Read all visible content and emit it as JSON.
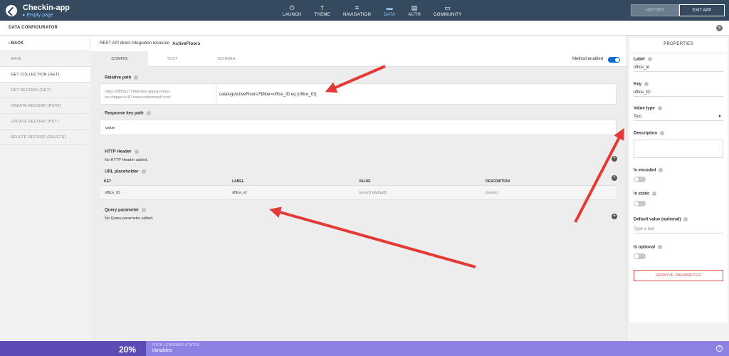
{
  "topbar": {
    "app_title": "Checkin-app",
    "app_subtitle": "▸ Empty page",
    "nav": [
      {
        "label": "LAUNCH",
        "icon": "launch-icon",
        "glyph": "⏻"
      },
      {
        "label": "THEME",
        "icon": "theme-icon",
        "glyph": "†"
      },
      {
        "label": "NAVIGATION",
        "icon": "navigation-icon",
        "glyph": "≡"
      },
      {
        "label": "DATA",
        "icon": "data-icon",
        "glyph": "▬"
      },
      {
        "label": "AUTH",
        "icon": "auth-icon",
        "glyph": "▤"
      },
      {
        "label": "COMMUNITY",
        "icon": "community-icon",
        "glyph": "▭"
      }
    ],
    "active_nav": "DATA",
    "history_label": "HISTORY",
    "exit_label": "EXIT APP"
  },
  "subbar": {
    "title": "DATA CONFIGURATOR"
  },
  "left": {
    "back_label": "‹  BACK",
    "items": [
      {
        "label": "BASE"
      },
      {
        "label": "GET COLLECTION (GET)"
      },
      {
        "label": "GET RECORD (GET)"
      },
      {
        "label": "CREATE RECORD (POST)"
      },
      {
        "label": "UPDATE RECORD (PUT)"
      },
      {
        "label": "DELETE RECORD (DELETE)"
      }
    ],
    "active_item": "GET COLLECTION (GET)"
  },
  "center": {
    "resource_prefix": "REST API direct integration resource",
    "resource_name": "ActiveFloors",
    "tabs": [
      "CONFIG",
      "TEST",
      "SCHEMA"
    ],
    "active_tab": "CONFIG",
    "method_enabled_label": "Method enabled",
    "method_enabled": true,
    "relative_path_label": "Relative path",
    "base_url": "https://9f55d177trial-dev-appgyverapi-srv.cfapps.us10.hana.ondemand.com/",
    "relative_path_value": "catalog/ActiveFloors?$filter=office_ID eq {office_ID}",
    "response_key_path_label": "Response key path",
    "response_key_path_value": "value",
    "http_header_label": "HTTP Header",
    "http_header_empty": "No HTTP Header added.",
    "url_placeholder_label": "URL placeholder",
    "table_headers": [
      "KEY",
      "LABEL",
      "VALUE",
      "DESCRIPTION"
    ],
    "table_rows": [
      {
        "key": "office_ID",
        "label": "office_id",
        "value": "(unset) (default)",
        "description": "(unset)"
      }
    ],
    "query_parameter_label": "Query parameter",
    "query_parameter_empty": "No Query parameter added."
  },
  "properties": {
    "title": "PROPERTIES",
    "label_label": "Label",
    "label_value": "office_id",
    "key_label": "Key",
    "key_value": "office_ID",
    "value_type_label": "Value type",
    "value_type_value": "Text",
    "description_label": "Description",
    "is_encoded_label": "Is encoded",
    "is_encoded": false,
    "is_static_label": "Is static",
    "is_static": false,
    "default_value_label": "Default value (optional)",
    "default_value_placeholder": "Type a text",
    "is_optional_label": "Is optional",
    "is_optional": false,
    "remove_label": "REMOVE PARAMETER"
  },
  "status": {
    "percent": "20%",
    "label": "YOUR LEARNING STATUS",
    "value": "Variables"
  },
  "colors": {
    "topbar": "#354a5f",
    "accent": "#0a6ed1",
    "arrow": "#e53935",
    "status_left": "#5b4bb4",
    "status_right": "#8c82e4",
    "remove": "#e34d4d"
  }
}
